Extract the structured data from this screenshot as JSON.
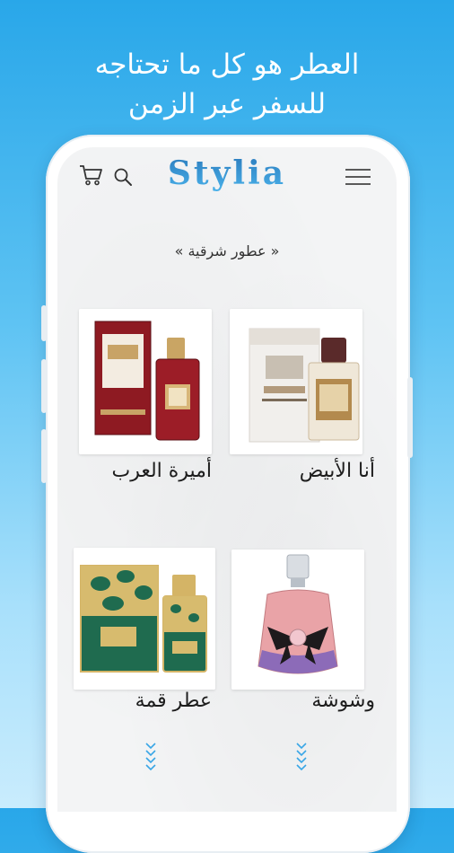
{
  "headline": {
    "line1": "العطر هو كل ما تحتاجه",
    "line2": "للسفر عبر الزمن"
  },
  "app": {
    "logo": "Stylia",
    "section_title": "« عطور شرقية »",
    "icons": {
      "cart": "cart-icon",
      "search": "search-icon",
      "menu": "hamburger-menu-icon",
      "more": "chevron-down-icon"
    }
  },
  "products": [
    {
      "name": "أنا الأبيض"
    },
    {
      "name": "أميرة العرب"
    },
    {
      "name": "وشوشة"
    },
    {
      "name": "عطر قمة"
    }
  ],
  "colors": {
    "accent": "#2f8fd3",
    "background_top": "#29a7e9",
    "background_bottom": "#c9ecfd"
  }
}
